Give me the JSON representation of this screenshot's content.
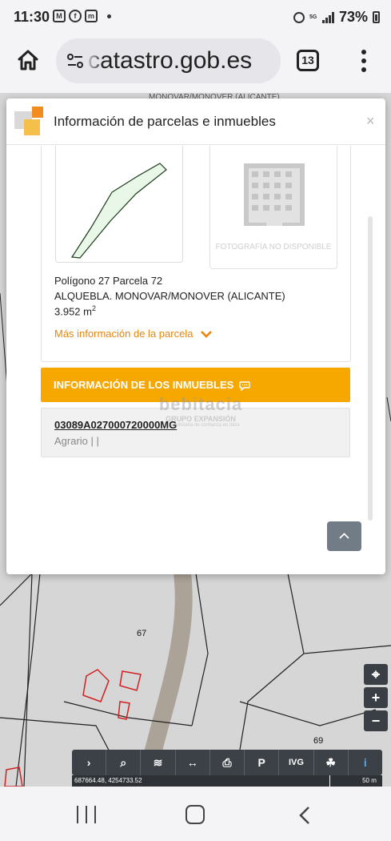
{
  "status_bar": {
    "time": "11:30",
    "battery": "73%",
    "network": "5G"
  },
  "browser": {
    "url": "catastro.gob.es",
    "tab_count": "13"
  },
  "dialog": {
    "title": "Información de parcelas e inmuebles",
    "close_label": "×",
    "parcel": {
      "no_photo_label": "FOTOGRAFÍA NO DISPONIBLE",
      "polygon_line": "Polígono 27 Parcela 72",
      "location_line": "ALQUEBLA. MONOVAR/MONOVER (ALICANTE)",
      "area_value": "3.952 m",
      "area_sup": "2",
      "more_info_label": "Más información de la parcela"
    },
    "inmuebles": {
      "header": "INFORMACIÓN DE LOS INMUEBLES",
      "items": [
        {
          "reference": "03089A027000720000MG",
          "use": "Agrario | |"
        }
      ]
    },
    "watermark": {
      "brand": "bebitacia",
      "group": "GRUPO EXPANSIÓN",
      "tagline": "Tu inmobiliaria de confianza en Ibiza"
    }
  },
  "map": {
    "top_label": "MONOVAR/MONOVER (ALICANTE)",
    "parcel_labels": [
      "67",
      "69"
    ],
    "controls": [
      "⌖",
      "+",
      "−"
    ],
    "toolbar": [
      "›",
      "⌕",
      "≋",
      "↔",
      "⎙",
      "P",
      "IVG",
      "☘",
      "i"
    ],
    "coordinates": "687664.48, 4254733.52",
    "scale": "50 m"
  }
}
